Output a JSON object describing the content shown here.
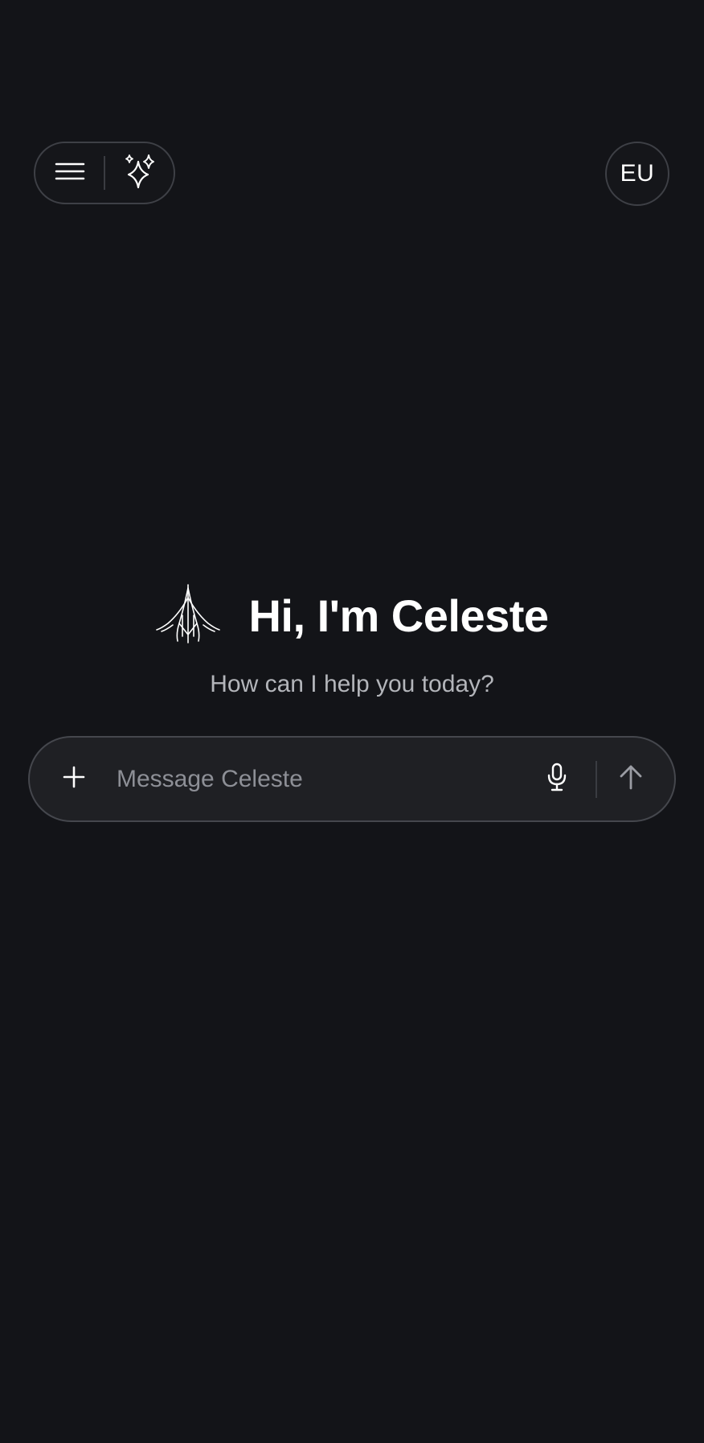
{
  "header": {
    "menu_icon": "menu-icon",
    "sparkle_icon": "sparkles-icon",
    "avatar_initials": "EU"
  },
  "hero": {
    "logo_icon": "celeste-logo-icon",
    "title": "Hi, I'm Celeste",
    "subtitle": "How can I help you today?"
  },
  "composer": {
    "add_icon": "plus-icon",
    "placeholder": "Message Celeste",
    "value": "",
    "mic_icon": "microphone-icon",
    "send_icon": "arrow-up-icon"
  },
  "colors": {
    "background": "#131418",
    "border": "#3e4046",
    "composer_bg": "#1f2024",
    "placeholder": "#8d8f96",
    "subtitle": "#b3b5ba"
  }
}
